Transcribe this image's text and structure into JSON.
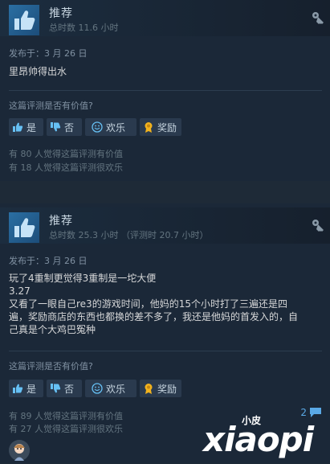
{
  "reviews": [
    {
      "verdict": "推荐",
      "hours": "总时数 11.6 小时",
      "posted": "发布于：3 月 26 日",
      "body": [
        "里昂帅得出水"
      ],
      "helpful_question": "这篇评测是否有价值?",
      "buttons": {
        "yes": "是",
        "no": "否",
        "funny": "欢乐",
        "award": "奖励"
      },
      "helpful_count": "有 80 人觉得这篇评测有价值",
      "funny_count": "有 18 人觉得这篇评测很欢乐"
    },
    {
      "verdict": "推荐",
      "hours": "总时数 25.3 小时 （评测时 20.7 小时）",
      "posted": "发布于：3 月 26 日",
      "body": [
        "玩了4重制更觉得3重制是一坨大便",
        "3.27",
        "又看了一眼自己re3的游戏时间，他妈的15个小时打了三遍还是四",
        "遍，奖励商店的东西也都换的差不多了，我还是他妈的首发入的，自",
        "己真是个大鸡巴冤种"
      ],
      "helpful_question": "这篇评测是否有价值?",
      "buttons": {
        "yes": "是",
        "no": "否",
        "funny": "欢乐",
        "award": "奖励"
      },
      "helpful_count": "有 89 人觉得这篇评测有价值",
      "funny_count": "有 27 人觉得这篇评测很欢乐",
      "comment_count": "2"
    }
  ],
  "watermark": {
    "small": "小皮",
    "big": "xiaopi"
  },
  "colors": {
    "accent": "#5aa9e6",
    "award": "#f2b31e",
    "background": "#1b2838"
  },
  "icons": [
    "thumbs-up-icon",
    "key-icon",
    "thumbs-down-icon",
    "smiley-icon",
    "award-icon",
    "comment-icon",
    "avatar-icon"
  ]
}
